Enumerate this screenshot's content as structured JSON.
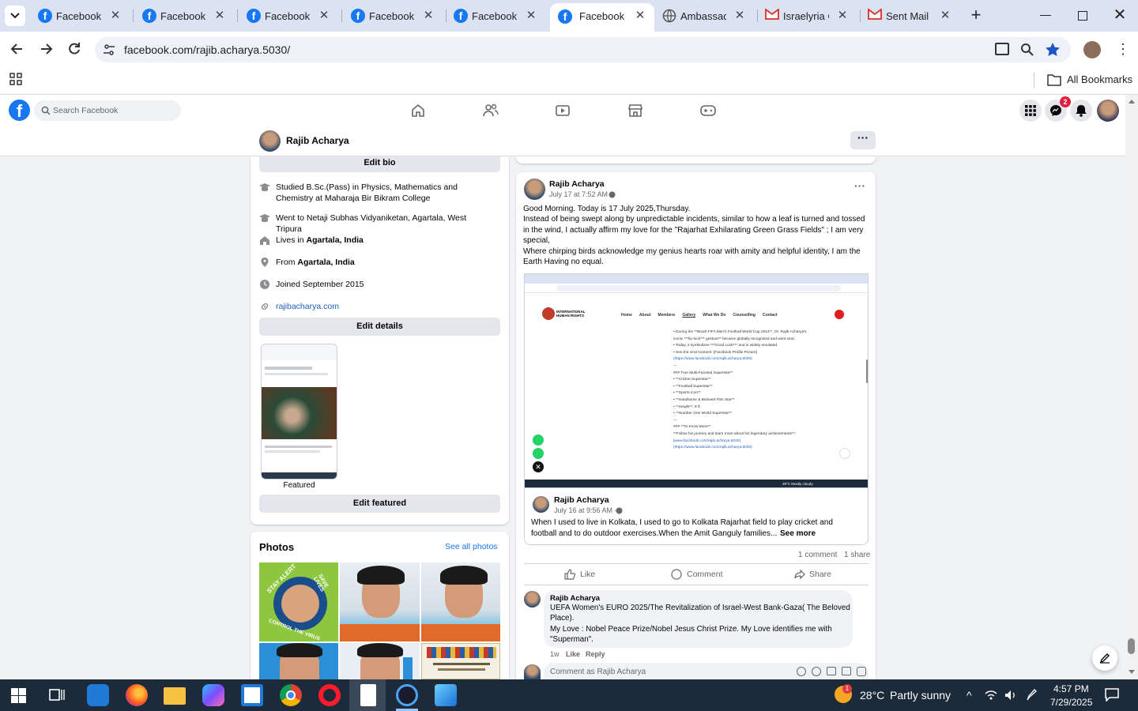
{
  "browser": {
    "tabs": [
      {
        "label": "Facebook",
        "active": false
      },
      {
        "label": "Facebook",
        "active": false
      },
      {
        "label": "Facebook",
        "active": false
      },
      {
        "label": "Facebook",
        "active": false
      },
      {
        "label": "Facebook",
        "active": false
      },
      {
        "label": "Facebook",
        "active": true
      },
      {
        "label": "Ambassadc",
        "active": false
      },
      {
        "label": "Israelyria C",
        "active": false
      },
      {
        "label": "Sent Mail -",
        "active": false
      }
    ],
    "url": "facebook.com/rajib.acharya.5030/",
    "bookmarks_label": "All Bookmarks"
  },
  "fb": {
    "search_placeholder": "Search Facebook",
    "messenger_badge": "2",
    "profile_name": "Rajib Acharya"
  },
  "intro": {
    "edit_bio": "Edit bio",
    "items": [
      {
        "icon": "graduation-cap-icon",
        "text": "Studied B.Sc.(Pass) in Physics, Mathematics and Chemistry at Maharaja Bir Bikram College"
      },
      {
        "icon": "graduation-cap-icon",
        "text": "Went to Netaji Subhas Vidyaniketan, Agartala, West Tripura"
      },
      {
        "icon": "home-icon",
        "prefix": "Lives in ",
        "bold": "Agartala, India"
      },
      {
        "icon": "location-pin-icon",
        "prefix": "From ",
        "bold": "Agartala, India"
      },
      {
        "icon": "clock-icon",
        "text": "Joined September 2015"
      },
      {
        "icon": "link-icon",
        "link": "rajibacharya.com"
      }
    ],
    "edit_details": "Edit details",
    "featured_label": "Featured",
    "edit_featured": "Edit featured"
  },
  "photos": {
    "title": "Photos",
    "see_all": "See all photos",
    "stay_alert_text": [
      "STAY ALERT",
      "SAVE LIVES",
      "CONTROL THE VIRUS"
    ]
  },
  "post": {
    "author": "Rajib Acharya",
    "time": "July 17 at 7:52 AM ·",
    "text_lines": [
      "Good Morning. Today is 17 July 2025,Thursday.",
      "Instead of being swept along by unpredictable incidents, similar to how a leaf is turned and tossed",
      "in the wind, I actually affirm my love for the \"Rajarhat Exhilarating Green Grass Fields\" ; I am very",
      "special,",
      "Where chirping birds acknowledge my genius hearts roar with amity and helpful identity,  I am the",
      "Earth Having no equal."
    ],
    "embedded_site": {
      "org": "INTERNATIONAL HUMAN RIGHTS",
      "nav": [
        "Home",
        "About",
        "Members",
        "Gallery",
        "What We Do",
        "Counselling",
        "Contact"
      ],
      "lines": [
        "• During the **Brazil FIFA Men's Football World Cup 2014**, Dr. Rajib Acharya's",
        "iconic ***lip-lock*** gesture** became globally recognized and went viral.",
        "• Today, it symbolizes ***Good Luck*** and is widely emulated.",
        "• See the viral moment: [Facebook Profile Picture]",
        "(https://www.facebook.com/rajib.acharya.5030)",
        "---",
        "### True Multi-Faceted Superstar**",
        "• **Cricket Superstar**",
        "• **Football Superstar**",
        "• **Sports Icon**",
        "• **Handsome & Beloved Film Star**",
        "• **Height**: 6 ft",
        "• **Number One World Superstar**",
        "---",
        "### **To Know More**",
        "**Follow his journey and learn more about his legendary achievements**:",
        "[www.facebook.com/rajib.acharya.5030]",
        "(https://www.facebook.com/rajib.acharya.5030)"
      ],
      "taskbar_weather": "29°C Mostly cloudy"
    },
    "shared": {
      "author": "Rajib Acharya",
      "time": "July 16 at 9:56 AM ·",
      "text_line1": "When I used to live in Kolkata, I used to go to Kolkata Rajarhat  field to play cricket and",
      "text_line2": "football and to do outdoor exercises.When the Amit Ganguly families...",
      "see_more": "See more"
    },
    "comments_count": "1 comment",
    "shares_count": "1 share",
    "like": "Like",
    "comment": "Comment",
    "share": "Share",
    "top_comment": {
      "author": "Rajib Acharya",
      "lines": [
        "UEFA Women's EURO 2025/The Revitalization of Israel-West Bank-Gaza( The Beloved",
        "Place).",
        "My Love : Nobel Peace Prize/Nobel Jesus Christ Prize. My Love identifies me with",
        "\"Superman\"."
      ],
      "age": "1w",
      "like": "Like",
      "reply": "Reply"
    },
    "comment_placeholder": "Comment as Rajib Acharya"
  },
  "taskbar": {
    "weather": "28°C",
    "weather_desc": "Partly sunny",
    "weather_badge": "1",
    "time": "4:57 PM",
    "date": "7/29/2025"
  }
}
